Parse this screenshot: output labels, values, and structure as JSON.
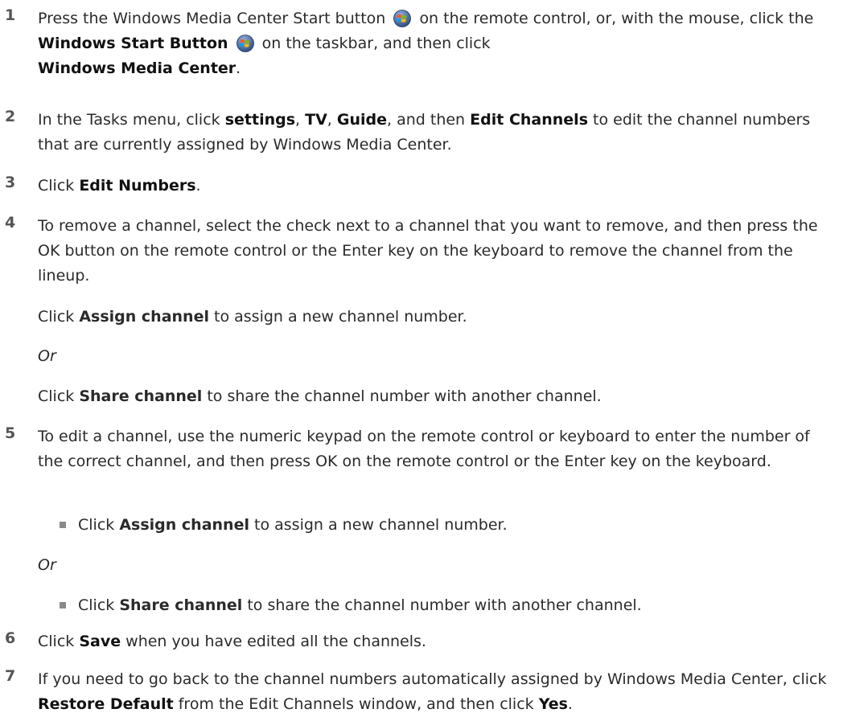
{
  "steps": [
    {
      "num": "1",
      "a": "Press the Windows Media Center Start button",
      "b": "on the remote control, or, with the mouse, click the",
      "c": "Windows Start Button",
      "d": "on the taskbar, and then click",
      "e": "Windows Media Center",
      "f": "."
    },
    {
      "num": "2",
      "a": "In the Tasks menu, click ",
      "b": "settings",
      "c": ", ",
      "d": "TV",
      "e": ", ",
      "f": "Guide",
      "g": ", and then ",
      "h": "Edit Channels",
      "i": " to edit the channel numbers that are currently assigned by Windows Media Center."
    },
    {
      "num": "3",
      "a": "Click ",
      "b": "Edit Numbers",
      "c": "."
    },
    {
      "num": "4",
      "a": "To remove a channel, select the check next to a channel that you want to remove, and then press the OK button on the remote control or the Enter key on the keyboard to remove the channel from the lineup.",
      "p1a": "Click ",
      "p1b": "Assign channel",
      "p1c": " to assign a new channel number.",
      "or": "Or",
      "p2a": "Click ",
      "p2b": "Share channel",
      "p2c": " to share the channel number with another channel."
    },
    {
      "num": "5",
      "a": "To edit a channel, use the numeric keypad on the remote control or keyboard to enter the number of the correct channel, and then press OK on the remote control or the Enter key on the keyboard.",
      "p1a": "Click ",
      "p1b": "Assign channel",
      "p1c": " to assign a new channel number.",
      "or": "Or",
      "p2a": "Click ",
      "p2b": "Share channel",
      "p2c": " to share the channel number with another channel."
    },
    {
      "num": "6",
      "a": "Click ",
      "b": "Save",
      "c": " when you have edited all the channels."
    },
    {
      "num": "7",
      "a": "If you need to go back to the channel numbers automatically assigned by Windows Media Center, click ",
      "b": "Restore Default",
      "c": " from the Edit Channels window, and then click ",
      "d": "Yes",
      "e": "."
    }
  ]
}
